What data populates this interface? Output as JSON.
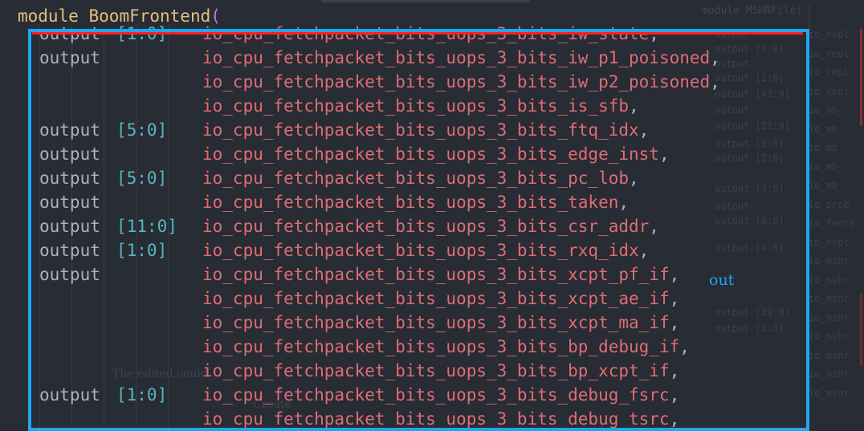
{
  "header": {
    "keyword": "module",
    "module_name": "BoomFrontend",
    "open_paren": "("
  },
  "minimap": {
    "title": "module MSHRFile(",
    "left_lines": [
      "output",
      "output [1:0]",
      "output",
      "output [1:0]",
      "output [43:0]",
      "output",
      "output [21:0]",
      "output [5:0]",
      "output [2:0]",
      "output [3:0]",
      "output",
      "output [6:0]",
      "output [4:0]",
      "output [39:0]",
      "output [3:0]"
    ],
    "right_lines": [
      "io_repl",
      "io_repl",
      "io_repl",
      "io_repl",
      "io_mb_",
      "io_mb_",
      "io_mb_",
      "io_mb_",
      "io_mb_",
      "io_prob",
      "io_fence",
      "io_repl",
      "io_mshr",
      "io_mshr",
      "io_mshr",
      "io_mshr",
      "io_mshr",
      "io_mshr",
      "io_mshr",
      "io_mshr"
    ]
  },
  "code_rows": [
    {
      "kw": "output",
      "width": "[1:0]",
      "name": "io_cpu_fetchpacket_bits_uops_3_bits_iw_state",
      "punct": ","
    },
    {
      "kw": "output",
      "width": "",
      "name": "io_cpu_fetchpacket_bits_uops_3_bits_iw_p1_poisoned",
      "punct": ","
    },
    {
      "kw": "",
      "width": "",
      "name": "io_cpu_fetchpacket_bits_uops_3_bits_iw_p2_poisoned",
      "punct": ","
    },
    {
      "kw": "",
      "width": "",
      "name": "io_cpu_fetchpacket_bits_uops_3_bits_is_sfb",
      "punct": ","
    },
    {
      "kw": "output",
      "width": "[5:0]",
      "name": "io_cpu_fetchpacket_bits_uops_3_bits_ftq_idx",
      "punct": ","
    },
    {
      "kw": "output",
      "width": "",
      "name": "io_cpu_fetchpacket_bits_uops_3_bits_edge_inst",
      "punct": ","
    },
    {
      "kw": "output",
      "width": "[5:0]",
      "name": "io_cpu_fetchpacket_bits_uops_3_bits_pc_lob",
      "punct": ","
    },
    {
      "kw": "output",
      "width": "",
      "name": "io_cpu_fetchpacket_bits_uops_3_bits_taken",
      "punct": ","
    },
    {
      "kw": "output",
      "width": "[11:0]",
      "name": "io_cpu_fetchpacket_bits_uops_3_bits_csr_addr",
      "punct": ","
    },
    {
      "kw": "output",
      "width": "[1:0]",
      "name": "io_cpu_fetchpacket_bits_uops_3_bits_rxq_idx",
      "punct": ","
    },
    {
      "kw": "output",
      "width": "",
      "name": "io_cpu_fetchpacket_bits_uops_3_bits_xcpt_pf_if",
      "punct": ","
    },
    {
      "kw": "",
      "width": "",
      "name": "io_cpu_fetchpacket_bits_uops_3_bits_xcpt_ae_if",
      "punct": ","
    },
    {
      "kw": "",
      "width": "",
      "name": "io_cpu_fetchpacket_bits_uops_3_bits_xcpt_ma_if",
      "punct": ","
    },
    {
      "kw": "",
      "width": "",
      "name": "io_cpu_fetchpacket_bits_uops_3_bits_bp_debug_if",
      "punct": ","
    },
    {
      "kw": "",
      "width": "",
      "name": "io_cpu_fetchpacket_bits_uops_3_bits_bp_xcpt_if",
      "punct": ","
    },
    {
      "kw": "output",
      "width": "[1:0]",
      "name": "io_cpu_fetchpacket_bits_uops_3_bits_debug_fsrc",
      "punct": ","
    },
    {
      "kw": "",
      "width": "",
      "name": "io_cpu_fetchpacket_bits_uops_3_bits_debug_tsrc",
      "punct": ","
    }
  ],
  "annotation": {
    "label": "out"
  },
  "ghost": {
    "text1": "The edited could",
    "text2": "Create"
  },
  "colors": {
    "background": "#282c34",
    "box": "#1ea7ee",
    "line": "#ff1f1f",
    "identifier": "#e06c75",
    "width": "#56b6c2"
  }
}
